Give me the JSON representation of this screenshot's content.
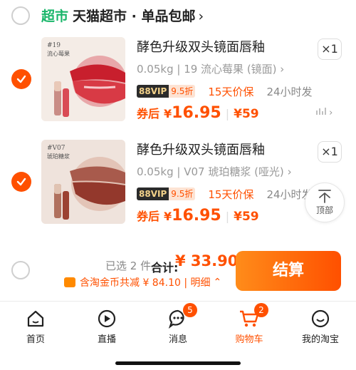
{
  "shop": {
    "tag": "超市",
    "name": "天猫超市 · 单品包邮",
    "chevron": "›"
  },
  "items": [
    {
      "title": "酵色升级双头镜面唇釉",
      "qty": "×1",
      "spec": "0.05kg | 19 流心莓果 (镜面)",
      "vip_a": "88VIP",
      "vip_b": "9.5折",
      "badge1": "15天价保",
      "badge2": "24小时发",
      "price_label": "券后",
      "price_currency": "¥",
      "price_value": "16.95",
      "price2": "¥59",
      "thumb_number": "#19",
      "thumb_name": "流心莓果",
      "color": "#d8343f"
    },
    {
      "title": "酵色升级双头镜面唇釉",
      "qty": "×1",
      "spec": "0.05kg | V07 琥珀糖浆 (哑光)",
      "vip_a": "88VIP",
      "vip_b": "9.5折",
      "badge1": "15天价保",
      "badge2": "24小时发",
      "price_label": "券后",
      "price_currency": "¥",
      "price_value": "16.95",
      "price2": "¥59",
      "thumb_number": "#V07",
      "thumb_name": "琥珀糖浆",
      "color": "#9c4232"
    }
  ],
  "back_top": {
    "label": "顶部"
  },
  "summary": {
    "selected": "已选 2 件,",
    "total_label": "合计:",
    "total_amount": "¥ 33.90",
    "discount": "含淘金币共减 ¥ 84.10 | 明细",
    "checkout": "结算"
  },
  "tabs": [
    {
      "label": "首页",
      "icon": "home-icon"
    },
    {
      "label": "直播",
      "icon": "live-icon"
    },
    {
      "label": "消息",
      "icon": "message-icon",
      "badge": "5"
    },
    {
      "label": "购物车",
      "icon": "cart-icon",
      "badge": "2"
    },
    {
      "label": "我的淘宝",
      "icon": "profile-icon"
    }
  ],
  "colors": {
    "accent": "#ff5000",
    "green": "#19b66a"
  }
}
